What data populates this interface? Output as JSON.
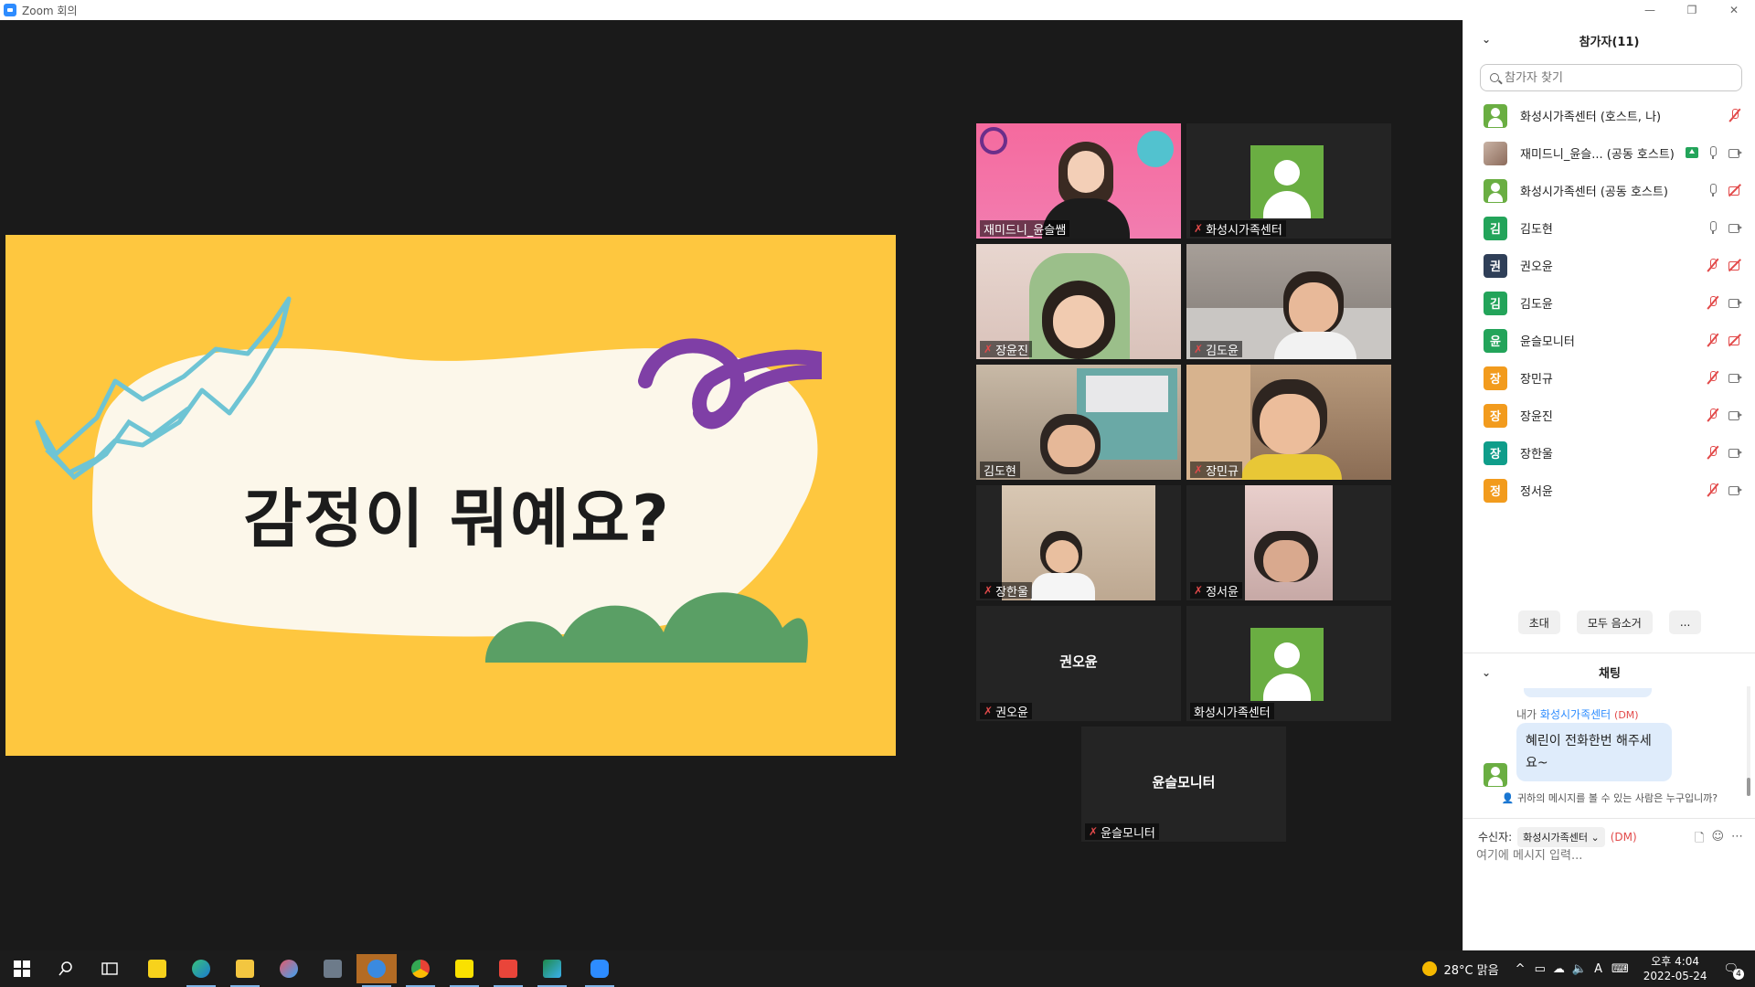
{
  "window": {
    "title": "Zoom 회의"
  },
  "slide": {
    "title": "감정이 뭐예요?"
  },
  "tiles": {
    "t1": {
      "name": "재미드니_윤슬쌤"
    },
    "t2": {
      "name": "화성시가족센터"
    },
    "t3": {
      "name": "장윤진"
    },
    "t4": {
      "name": "김도윤"
    },
    "t5": {
      "name": "김도현"
    },
    "t6": {
      "name": "장민규"
    },
    "t7": {
      "name": "장한울"
    },
    "t8": {
      "name": "정서윤"
    },
    "t9": {
      "name": "권오윤",
      "center": "권오윤"
    },
    "t10": {
      "name": "화성시가족센터"
    },
    "t11": {
      "name": "윤슬모니터",
      "center": "윤슬모니터"
    }
  },
  "participants": {
    "title": "참가자(11)",
    "search_placeholder": "참가자 찾기",
    "list": [
      {
        "name": "화성시가족센터 (호스트, 나)",
        "initial": "",
        "mic": "off",
        "cam": "none"
      },
      {
        "name": "재미드니_윤슬... (공동 호스트)",
        "initial": "",
        "mic": "on",
        "cam": "on"
      },
      {
        "name": "화성시가족센터 (공동 호스트)",
        "initial": "",
        "mic": "on",
        "cam": "off"
      },
      {
        "name": "김도현",
        "initial": "김",
        "mic": "on",
        "cam": "on"
      },
      {
        "name": "권오윤",
        "initial": "권",
        "mic": "off",
        "cam": "off"
      },
      {
        "name": "김도윤",
        "initial": "김",
        "mic": "off",
        "cam": "on"
      },
      {
        "name": "윤슬모니터",
        "initial": "윤",
        "mic": "off",
        "cam": "off"
      },
      {
        "name": "장민규",
        "initial": "장",
        "mic": "off",
        "cam": "on"
      },
      {
        "name": "장윤진",
        "initial": "장",
        "mic": "off",
        "cam": "on"
      },
      {
        "name": "장한울",
        "initial": "장",
        "mic": "off",
        "cam": "on"
      },
      {
        "name": "정서윤",
        "initial": "정",
        "mic": "off",
        "cam": "on"
      }
    ],
    "buttons": {
      "invite": "초대",
      "mute_all": "모두 음소거",
      "more": "..."
    }
  },
  "chat": {
    "title": "채팅",
    "meta_prefix": "내가",
    "meta_to": "화성시가족센터",
    "meta_dm": "(DM)",
    "message": "혜린이 전화한번 해주세요~",
    "who_can_see": "귀하의 메시지를 볼 수 있는 사람은 누구입니까?",
    "recipient_label": "수신자:",
    "recipient": "화성시가족센터",
    "recipient_dm": "(DM)",
    "input_placeholder": "여기에 메시지 입력..."
  },
  "taskbar": {
    "weather": "28°C 맑음",
    "time": "오후 4:04",
    "date": "2022-05-24",
    "notifications": "4",
    "ime": "A"
  },
  "colors": {
    "slide_bg": "#fec73f",
    "accent_blue": "#2d8cff",
    "muted_red": "#e24a4a",
    "active_speaker": "#c8e044"
  }
}
